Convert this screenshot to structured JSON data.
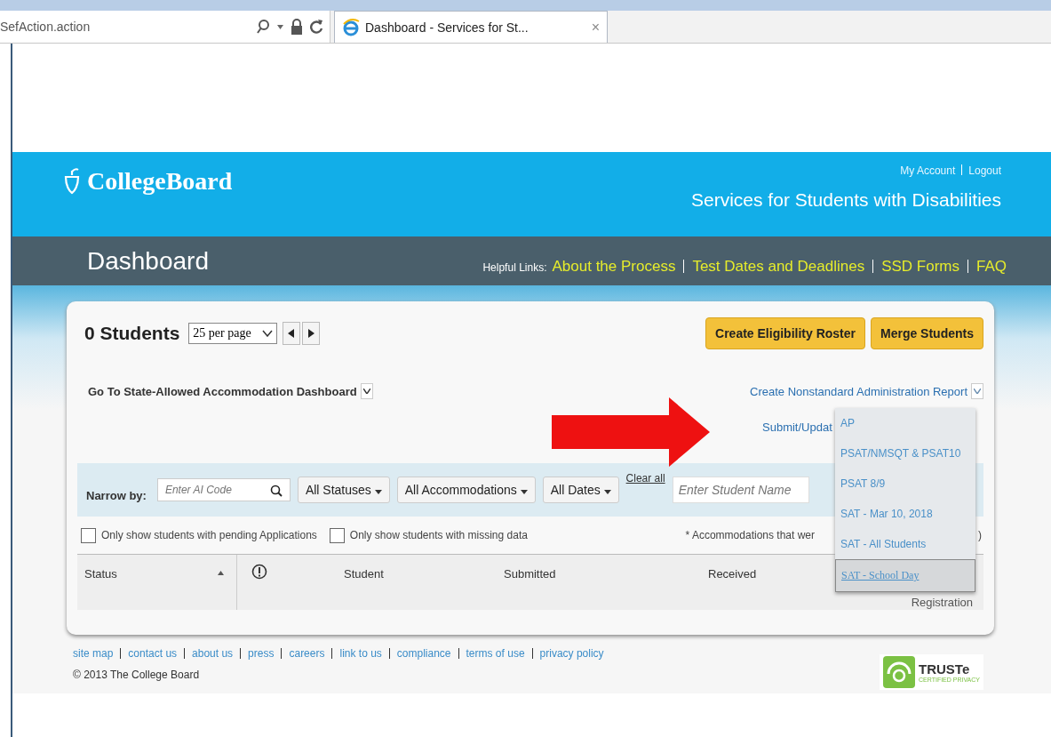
{
  "browser": {
    "address": "SefAction.action",
    "tab": {
      "title": "Dashboard - Services for St...",
      "close": "×"
    }
  },
  "header": {
    "logo": "CollegeBoard",
    "account_links": [
      "My Account",
      "Logout"
    ],
    "subtitle": "Services for Students with Disabilities"
  },
  "nav": {
    "title": "Dashboard",
    "helpful_label": "Helpful Links:",
    "links": [
      "About the Process",
      "Test Dates and Deadlines",
      "SSD Forms",
      "FAQ"
    ]
  },
  "card": {
    "count": "0 Students",
    "per_page": "25 per page",
    "buttons": [
      "Create Eligibility Roster",
      "Merge Students"
    ],
    "state_link": "Go To State-Allowed Accommodation Dashboard",
    "report_link": "Create Nonstandard Administration Report",
    "submit_link": "Submit/Updat",
    "filter": {
      "label": "Narrow by:",
      "ai_code": {
        "placeholder": "Enter AI Code"
      },
      "dropdowns": [
        "All Statuses",
        "All Accommodations",
        "All Dates"
      ],
      "clear": "Clear all",
      "student": {
        "placeholder": "Enter Student Name"
      }
    },
    "checkboxes": [
      {
        "label": "Only show students with pending Applications",
        "checked": false
      },
      {
        "label": "Only show students with missing data",
        "checked": false
      }
    ],
    "note": "* Accommodations that wer",
    "note_tail": ")",
    "table": {
      "columns": [
        "Status",
        "Student",
        "Submitted",
        "Received"
      ],
      "column_6": "Registration"
    },
    "report_menu": [
      {
        "label": "AP",
        "selected": false
      },
      {
        "label": "PSAT/NMSQT & PSAT10",
        "selected": false
      },
      {
        "label": "PSAT 8/9",
        "selected": false
      },
      {
        "label": "SAT - Mar 10, 2018",
        "selected": false
      },
      {
        "label": "SAT - All Students",
        "selected": false
      },
      {
        "label": "SAT - School Day",
        "selected": true
      }
    ]
  },
  "footer": {
    "links": [
      "site map",
      "contact us",
      "about us",
      "press",
      "careers",
      "link to us",
      "compliance",
      "terms of use",
      "privacy policy"
    ],
    "copyright": "© 2013 The College Board",
    "badge": {
      "title": "TRUSTe",
      "subtitle": "CERTIFIED PRIVACY"
    }
  }
}
